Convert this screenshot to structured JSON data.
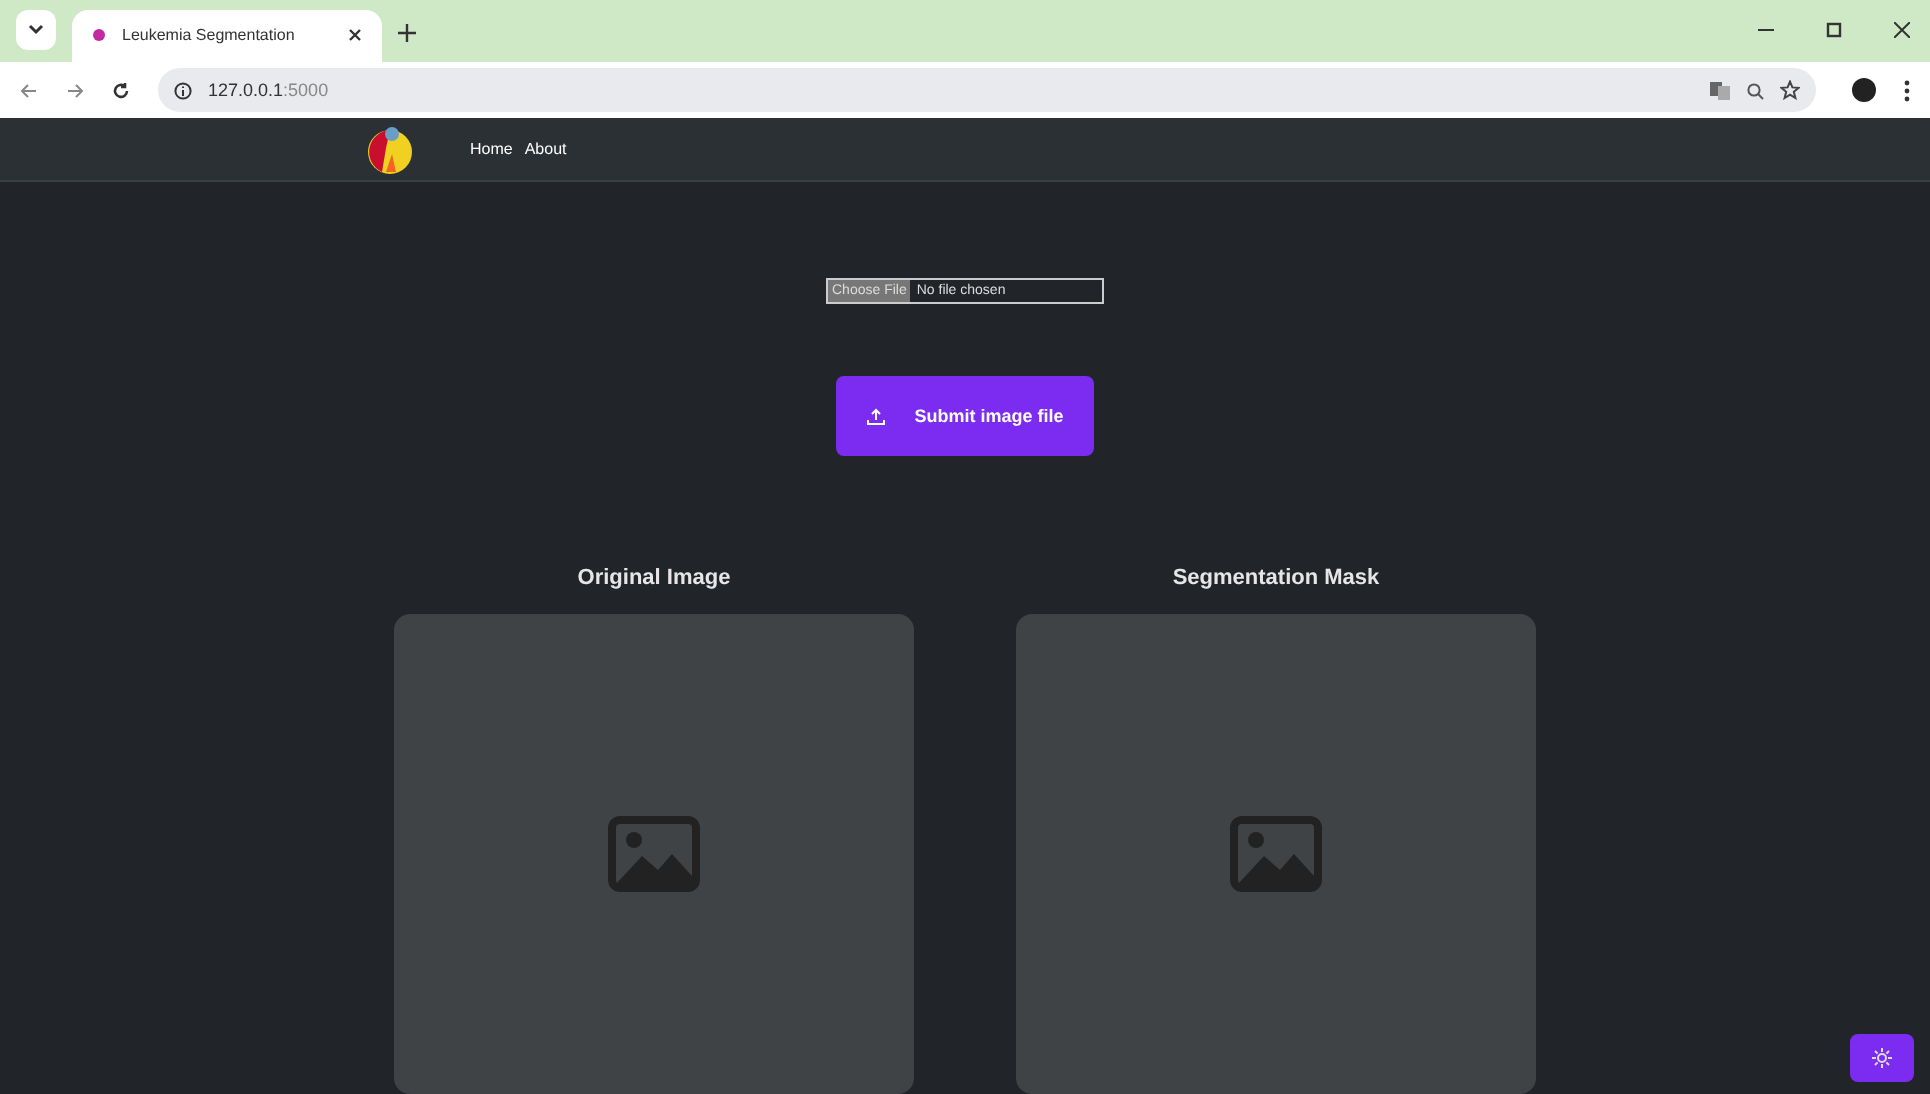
{
  "browser": {
    "tab_title": "Leukemia Segmentation",
    "url_host": "127.0.0.1",
    "url_port": ":5000"
  },
  "nav": {
    "links": [
      "Home",
      "About"
    ]
  },
  "upload": {
    "choose_label": "Choose File",
    "file_status": "No file chosen",
    "submit_label": "Submit image file"
  },
  "panels": [
    {
      "title": "Original Image"
    },
    {
      "title": "Segmentation Mask"
    }
  ]
}
